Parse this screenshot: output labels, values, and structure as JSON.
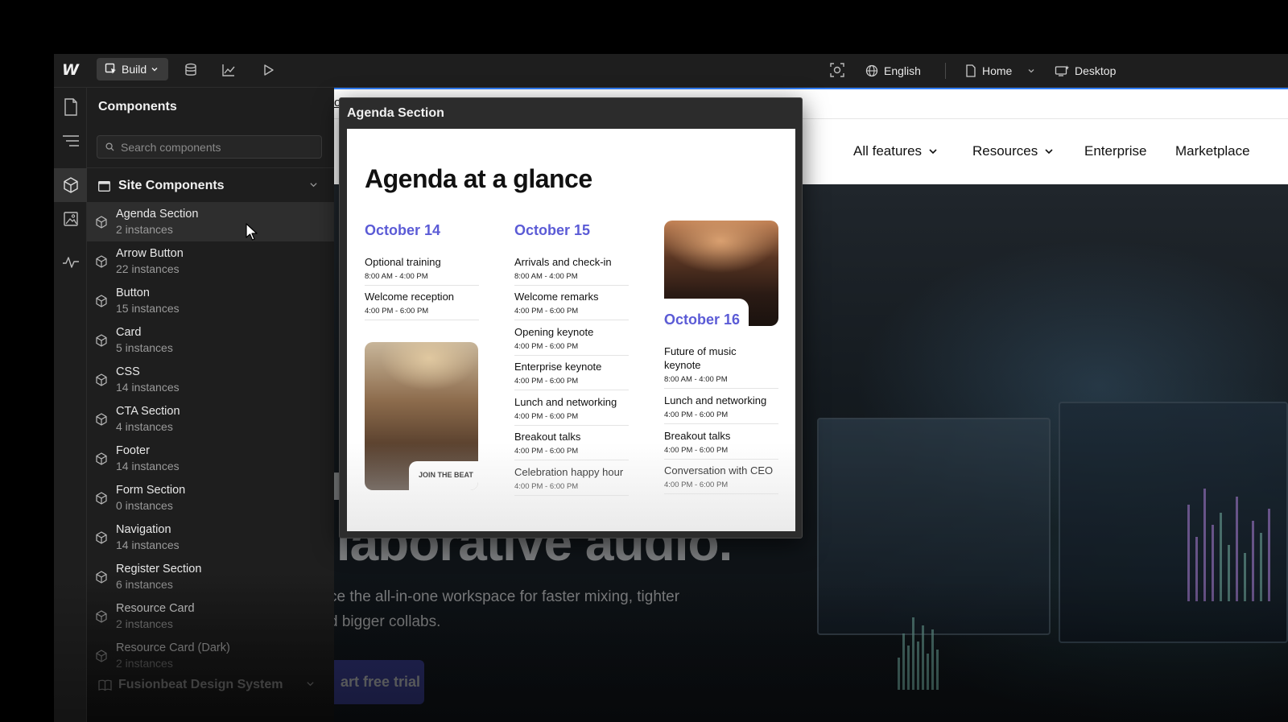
{
  "topbar": {
    "logo": "W",
    "build_label": "Build",
    "language": "English",
    "page": "Home",
    "breakpoint": "Desktop",
    "icons": [
      "database-icon",
      "analytics-icon",
      "play-icon",
      "screenshot-icon",
      "globe-icon",
      "page-icon",
      "chevron-down-icon",
      "desktop-icon"
    ]
  },
  "rail": {
    "icons": [
      "pages-icon",
      "navigator-icon",
      "components-icon",
      "assets-icon",
      "activity-icon"
    ],
    "active": "components-icon"
  },
  "panel": {
    "title": "Components",
    "search_placeholder": "Search components",
    "section_title": "Site Components",
    "items": [
      {
        "name": "Agenda Section",
        "count": "2 instances"
      },
      {
        "name": "Arrow Button",
        "count": "22 instances"
      },
      {
        "name": "Button",
        "count": "15 instances"
      },
      {
        "name": "Card",
        "count": "5 instances"
      },
      {
        "name": "CSS",
        "count": "14 instances"
      },
      {
        "name": "CTA Section",
        "count": "4 instances"
      },
      {
        "name": "Footer",
        "count": "14 instances"
      },
      {
        "name": "Form Section",
        "count": "0 instances"
      },
      {
        "name": "Navigation",
        "count": "14 instances"
      },
      {
        "name": "Register Section",
        "count": "6 instances"
      },
      {
        "name": "Resource Card",
        "count": "2 instances"
      },
      {
        "name": "Resource Card (Dark)",
        "count": "2 instances"
      }
    ],
    "library_title": "Fusionbeat Design System"
  },
  "canvas": {
    "url_fragment": "o",
    "nav": [
      "All features",
      "Resources",
      "Enterprise",
      "Marketplace"
    ],
    "hero_line1": "r",
    "hero_line2": "llaborative audio.",
    "hero_sub1": "ce the all-in-one workspace for faster mixing, tighter",
    "hero_sub2": "d bigger collabs.",
    "cta": "art free trial"
  },
  "preview": {
    "title": "Agenda Section",
    "heading": "Agenda at a glance",
    "photo_tag": "JOIN THE BEAT",
    "days": [
      {
        "label": "October 14",
        "events": [
          {
            "title": "Optional training",
            "time": "8:00 AM - 4:00 PM"
          },
          {
            "title": "Welcome reception",
            "time": "4:00 PM - 6:00 PM"
          }
        ]
      },
      {
        "label": "October 15",
        "events": [
          {
            "title": "Arrivals and check-in",
            "time": "8:00 AM - 4:00 PM"
          },
          {
            "title": "Welcome remarks",
            "time": "4:00 PM - 6:00 PM"
          },
          {
            "title": "Opening keynote",
            "time": "4:00 PM - 6:00 PM"
          },
          {
            "title": "Enterprise keynote",
            "time": "4:00 PM - 6:00 PM"
          },
          {
            "title": "Lunch and networking",
            "time": "4:00 PM - 6:00 PM"
          },
          {
            "title": "Breakout talks",
            "time": "4:00 PM - 6:00 PM"
          },
          {
            "title": "Celebration happy hour",
            "time": "4:00 PM - 6:00 PM"
          }
        ]
      },
      {
        "label": "October 16",
        "events": [
          {
            "title": "Future of music keynote",
            "time": "8:00 AM - 4:00 PM"
          },
          {
            "title": "Lunch and networking",
            "time": "4:00 PM - 6:00 PM"
          },
          {
            "title": "Breakout talks",
            "time": "4:00 PM - 6:00 PM"
          },
          {
            "title": "Conversation with CEO",
            "time": "4:00 PM - 6:00 PM"
          }
        ]
      }
    ]
  },
  "colors": {
    "accent_day": "#5b5bd6",
    "selection_blue": "#2f7df6",
    "panel_bg": "#1e1e1e"
  }
}
